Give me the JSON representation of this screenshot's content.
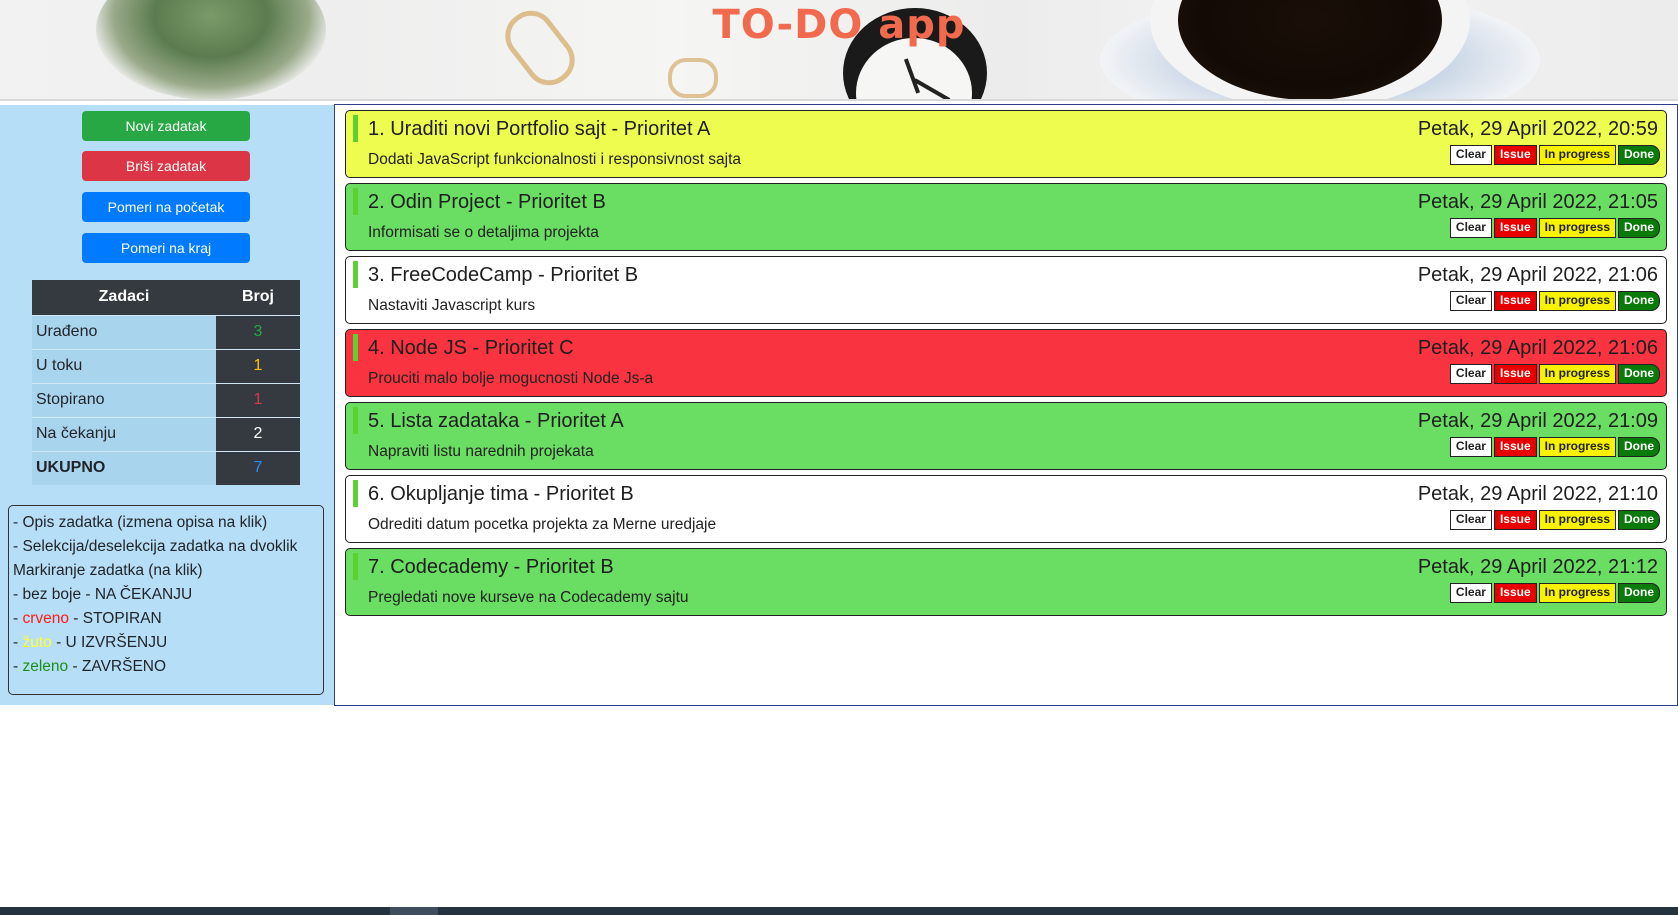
{
  "header": {
    "title": "TO-DO app"
  },
  "sidebar": {
    "buttons": {
      "new_task": "Novi zadatak",
      "delete_task": "Briši zadatak",
      "move_to_start": "Pomeri na početak",
      "move_to_end": "Pomeri na kraj"
    },
    "stats": {
      "col_tasks": "Zadaci",
      "col_count": "Broj",
      "rows": [
        {
          "label": "Urađeno",
          "value": "3",
          "color": "#28a745"
        },
        {
          "label": "U toku",
          "value": "1",
          "color": "#ffc107"
        },
        {
          "label": "Stopirano",
          "value": "1",
          "color": "#dc3545"
        },
        {
          "label": "Na čekanju",
          "value": "2",
          "color": "#ffffff"
        },
        {
          "label": "UKUPNO",
          "value": "7",
          "color": "#1e90ff"
        }
      ]
    },
    "legend": {
      "line1": "- Opis zadatka (izmena opisa na klik)",
      "line2": "- Selekcija/deselekcija zadatka na dvoklik",
      "line3": "Markiranje zadatka (na klik)",
      "line4": "- bez boje - NA ČEKANJU",
      "line5_prefix": "- ",
      "line5_color": "crveno",
      "line5_suffix": " - STOPIRAN",
      "line6_prefix": "- ",
      "line6_color": "žuto",
      "line6_suffix": " - U IZVRŠENJU",
      "line7_prefix": "- ",
      "line7_color": "zeleno",
      "line7_suffix": " - ZAVRŠENO"
    }
  },
  "actions": {
    "clear": "Clear",
    "issue": "Issue",
    "in_progress": "In progress",
    "done": "Done"
  },
  "tasks": [
    {
      "title": "1. Uraditi novi Portfolio sajt - Prioritet A",
      "date": "Petak, 29 April 2022, 20:59",
      "desc": "Dodati JavaScript funkcionalnosti i responsivnost sajta",
      "status": "yellow"
    },
    {
      "title": "2. Odin Project - Prioritet B",
      "date": "Petak, 29 April 2022, 21:05",
      "desc": "Informisati se o detaljima projekta",
      "status": "green"
    },
    {
      "title": "3. FreeCodeCamp - Prioritet B",
      "date": "Petak, 29 April 2022, 21:06",
      "desc": "Nastaviti Javascript kurs",
      "status": "white"
    },
    {
      "title": "4. Node JS - Prioritet C",
      "date": "Petak, 29 April 2022, 21:06",
      "desc": "Prouciti malo bolje mogucnosti Node Js-a",
      "status": "red"
    },
    {
      "title": "5. Lista zadataka - Prioritet A",
      "date": "Petak, 29 April 2022, 21:09",
      "desc": "Napraviti listu narednih projekata",
      "status": "green"
    },
    {
      "title": "6. Okupljanje tima - Prioritet B",
      "date": "Petak, 29 April 2022, 21:10",
      "desc": "Odrediti datum pocetka projekta za Merne uredjaje",
      "status": "white"
    },
    {
      "title": "7. Codecademy - Prioritet B",
      "date": "Petak, 29 April 2022, 21:12",
      "desc": "Pregledati nove kurseve na Codecademy sajtu",
      "status": "green"
    }
  ]
}
